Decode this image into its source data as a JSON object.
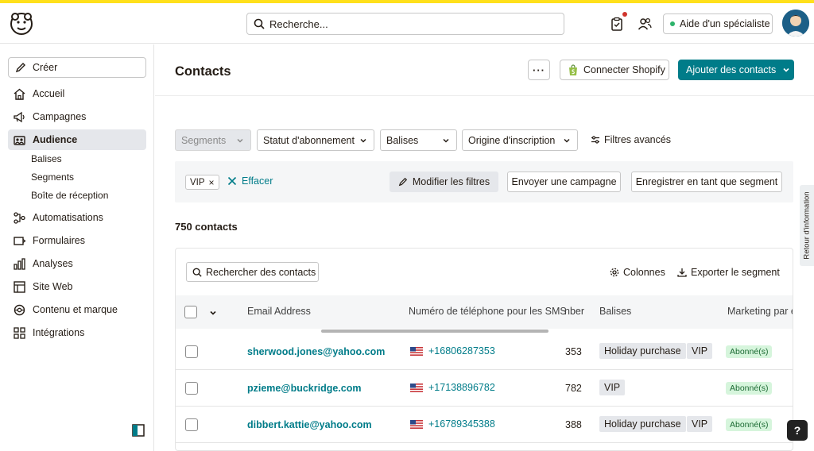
{
  "topbar": {
    "search_placeholder": "Recherche...",
    "expert_label": "Aide d'un spécialiste"
  },
  "sidebar": {
    "create_label": "Créer",
    "items": [
      {
        "label": "Accueil",
        "icon": "home-icon"
      },
      {
        "label": "Campagnes",
        "icon": "megaphone-icon"
      },
      {
        "label": "Audience",
        "icon": "audience-icon",
        "active": true
      },
      {
        "label": "Automatisations",
        "icon": "automation-icon"
      },
      {
        "label": "Formulaires",
        "icon": "form-icon"
      },
      {
        "label": "Analyses",
        "icon": "chart-icon"
      },
      {
        "label": "Site Web",
        "icon": "website-icon"
      },
      {
        "label": "Contenu et marque",
        "icon": "brand-icon"
      },
      {
        "label": "Intégrations",
        "icon": "grid-icon"
      }
    ],
    "audience_subitems": [
      "Balises",
      "Segments",
      "Boîte de réception"
    ]
  },
  "header": {
    "title": "Contacts",
    "more_label": "···",
    "shopify_label": "Connecter Shopify",
    "add_contacts_label": "Ajouter des contacts"
  },
  "filters": {
    "segments": "Segments",
    "subscription_status": "Statut d'abonnement",
    "tags": "Balises",
    "signup_source": "Origine d'inscription",
    "advanced": "Filtres avancés"
  },
  "filterbar": {
    "chip": "VIP",
    "chip_remove": "×",
    "clear": "Effacer",
    "edit_filters": "Modifier les filtres",
    "send_campaign": "Envoyer une campagne",
    "save_segment": "Enregistrer en tant que segment"
  },
  "summary": {
    "count": "750 contacts"
  },
  "table": {
    "search_label": "Rechercher des contacts",
    "columns_label": "Colonnes",
    "export_label": "Exporter le segment",
    "headers": {
      "email": "Email Address",
      "phone": "Numéro de téléphone pour les SMS",
      "partial": "nber",
      "tags": "Balises",
      "marketing": "Marketing par e"
    },
    "rows": [
      {
        "email": "sherwood.jones@yahoo.com",
        "phone": "+16806287353",
        "partial": "353",
        "tags": [
          "Holiday purchase",
          "VIP"
        ],
        "status": "Abonné(s)"
      },
      {
        "email": "pzieme@buckridge.com",
        "phone": "+17138896782",
        "partial": "782",
        "tags": [
          "VIP"
        ],
        "status": "Abonné(s)"
      },
      {
        "email": "dibbert.kattie@yahoo.com",
        "phone": "+16789345388",
        "partial": "388",
        "tags": [
          "Holiday purchase",
          "VIP"
        ],
        "status": "Abonné(s)"
      }
    ]
  },
  "feedback_tab": "Retour d'information",
  "help_label": "?",
  "colors": {
    "accent": "#007c89",
    "brand_yellow": "#ffe01b",
    "active_nav": "#e5e7eb",
    "subscribed_badge": "#d6f5dc"
  }
}
